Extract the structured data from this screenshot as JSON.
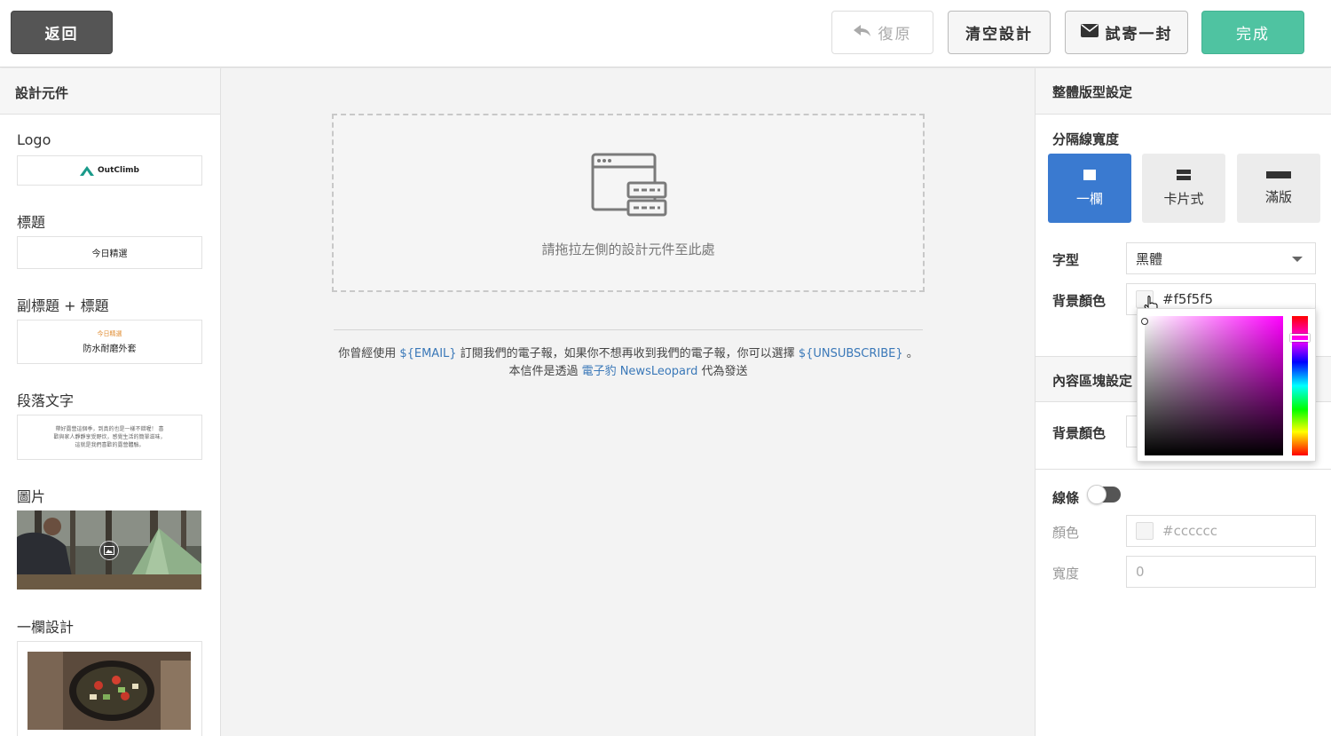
{
  "toolbar": {
    "back_label": "返回",
    "undo_label": "復原",
    "clear_label": "清空設計",
    "test_label": "試寄一封",
    "done_label": "完成"
  },
  "left_panel": {
    "title": "設計元件",
    "logo_label": "Logo",
    "logo_brand": "OutClimb",
    "title_label": "標題",
    "title_preview": "今日精選",
    "subtitle_label": "副標題 + 標題",
    "subtitle_preview_small": "今日精選",
    "subtitle_preview_title": "防水耐磨外套",
    "paragraph_label": "段落文字",
    "paragraph_preview": "帶好露營這個季，到真的也是一樣不錯喔！ 喜歡與家人靜靜享受野炊，感覺生活的簡單滋味， 這就是我們喜歡的露營體驗。",
    "image_label": "圖片",
    "column_label": "一欄設計"
  },
  "canvas": {
    "drop_text": "請拖拉左側的設計元件至此處",
    "footer_line1_a": "你曾經使用 ",
    "footer_email": "${EMAIL}",
    "footer_line1_b": " 訂閱我們的電子報，如果你不想再收到我們的電子報，你可以選擇 ",
    "footer_unsub": "${UNSUBSCRIBE}",
    "footer_line1_c": " 。",
    "footer_line2_a": "本信件是透過 ",
    "footer_brand": "電子豹 NewsLeopard",
    "footer_line2_b": " 代為發送"
  },
  "right_panel": {
    "title": "整體版型設定",
    "divider_width_label": "分隔線寬度",
    "layout_options": [
      "一欄",
      "卡片式",
      "滿版"
    ],
    "font_label": "字型",
    "font_value": "黑體",
    "bg_color_label": "背景顏色",
    "bg_color_value": "#f5f5f5",
    "content_section_title": "內容區塊設定",
    "content_bg_label": "背景顏色",
    "line_label": "線條",
    "line_color_label": "顏色",
    "line_color_value": "#cccccc",
    "line_width_label": "寬度",
    "line_width_value": "0"
  },
  "colors": {
    "primary": "#3a7ad0",
    "done": "#4fc3a1",
    "back": "#555555",
    "link": "#3a78b8"
  }
}
